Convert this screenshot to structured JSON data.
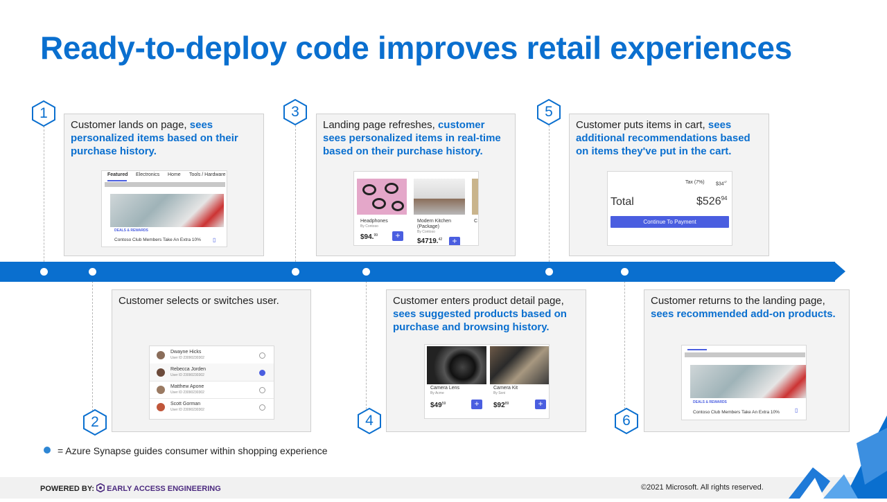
{
  "title": "Ready-to-deploy code improves retail experiences",
  "steps": [
    {
      "num": "1",
      "text": "Customer lands on page, ",
      "highlight": "sees personalized items based on their purchase history."
    },
    {
      "num": "2",
      "text": "Customer selects or switches user.",
      "highlight": ""
    },
    {
      "num": "3",
      "text": "Landing page refreshes, ",
      "highlight": "customer sees personalized items in real-time based on their purchase history."
    },
    {
      "num": "4",
      "text": "Customer enters product detail page, ",
      "highlight": "sees suggested products based on purchase and browsing history."
    },
    {
      "num": "5",
      "text": "Customer puts items in cart, ",
      "highlight": "sees additional recommendations based on items they've put in the cart."
    },
    {
      "num": "6",
      "text": "Customer returns to the landing page, ",
      "highlight": "sees recommended add-on products."
    }
  ],
  "mock1": {
    "tabs": [
      "Featured",
      "Electronics",
      "Home",
      "Tools / Hardware"
    ],
    "deal_label": "DEALS & REWARDS",
    "deal_text": "Contoso Club Members Take An Extra 10%"
  },
  "mock2": {
    "users": [
      {
        "name": "Dwayne Hicks",
        "id": "User ID 23090230302",
        "selected": false
      },
      {
        "name": "Rebecca Jorden",
        "id": "User ID 23090230302",
        "selected": true
      },
      {
        "name": "Matthew Apone",
        "id": "User ID 23090230302",
        "selected": false
      },
      {
        "name": "Scott Gorman",
        "id": "User ID 23090230302",
        "selected": false
      }
    ]
  },
  "mock3": {
    "products": [
      {
        "name": "Headphones",
        "brand": "By Contoso",
        "price": "$94.",
        "cents": "99"
      },
      {
        "name": "Modern Kitchen (Package)",
        "brand": "By Contoso",
        "price": "$4719.",
        "cents": "42"
      }
    ],
    "partial": "C"
  },
  "mock4": {
    "products": [
      {
        "name": "Camera Lens",
        "brand": "By Acme",
        "price": "$49",
        "cents": "59"
      },
      {
        "name": "Camera Kit",
        "brand": "By Soni",
        "price": "$92",
        "cents": "89"
      }
    ]
  },
  "mock5": {
    "tax_label": "Tax (7%)",
    "tax_value": "$34",
    "tax_cents": "47",
    "total_label": "Total",
    "total_value": "$526",
    "total_cents": "94",
    "button": "Continue To Payment"
  },
  "mock6": {
    "deal_label": "DEALS & REWARDS",
    "deal_text": "Contoso Club Members Take An Extra 10%"
  },
  "legend": "= Azure Synapse guides consumer within shopping experience",
  "footer": {
    "powered_by": "POWERED BY:",
    "brand": "EARLY ACCESS ENGINEERING",
    "copyright": "©2021 Microsoft. All rights reserved."
  },
  "colors": {
    "accent": "#0a6fcf",
    "card_bg": "#f3f3f3",
    "button": "#4a5ee0"
  }
}
